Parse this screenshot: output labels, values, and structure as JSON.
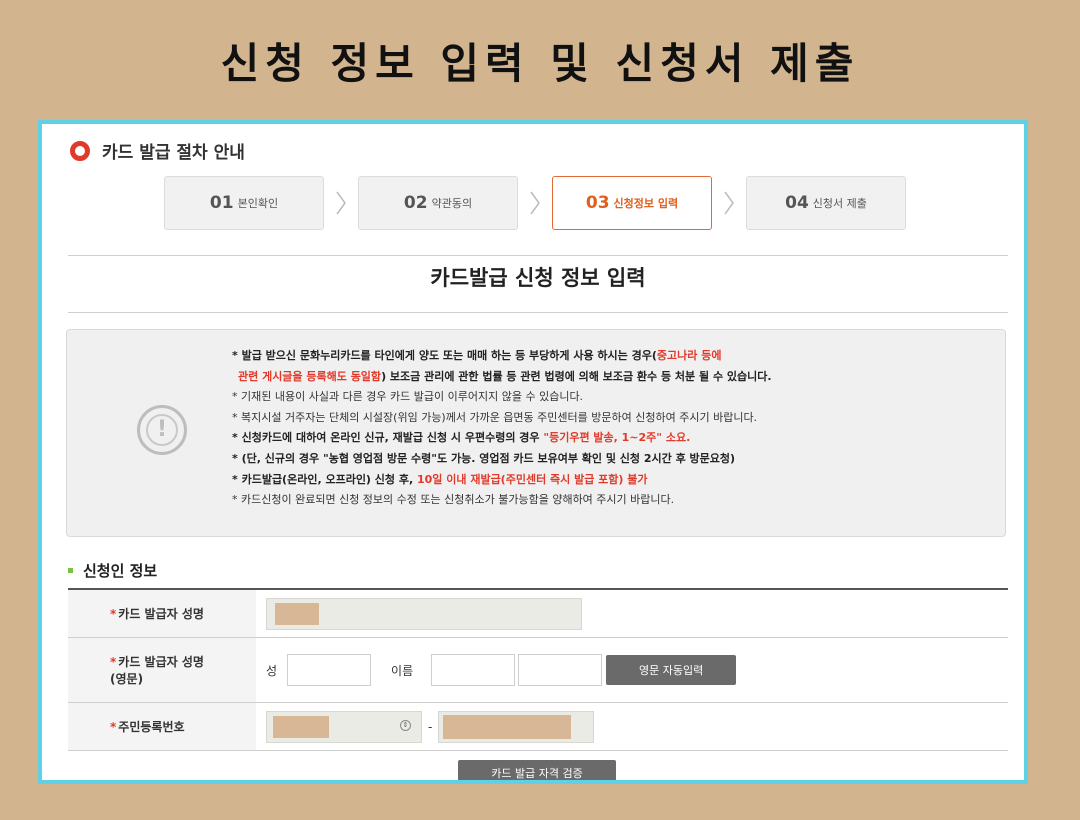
{
  "headline": "신청 정보 입력 및 신청서 제출",
  "guide_title": "카드 발급 절차 안내",
  "steps": [
    {
      "num": "01",
      "label": "본인확인"
    },
    {
      "num": "02",
      "label": "약관동의"
    },
    {
      "num": "03",
      "label": "신청정보 입력"
    },
    {
      "num": "04",
      "label": "신청서 제출"
    }
  ],
  "active_step": 3,
  "section_title": "카드발급 신청 정보 입력",
  "notice": {
    "lines": [
      {
        "pre": "* 발급 받으신 문화누리카드를 타인에게 양도 또는 매매 하는 등 부당하게 사용 하시는 경우(",
        "red": "중고나라 등에",
        "post": ""
      },
      {
        "pre": "",
        "red": "관련 게시글을 등록해도 동일함",
        "post": ") 보조금 관리에 관한 법률 등 관련 법령에 의해 보조금 환수 등 처분 될 수 있습니다."
      },
      {
        "text": "* 기재된 내용이 사실과 다른 경우 카드 발급이 이루어지지 않을 수 있습니다."
      },
      {
        "text": "* 복지시설 거주자는 단체의 시설장(위임 가능)께서 가까운 읍면동 주민센터를 방문하여 신청하여 주시기 바랍니다."
      },
      {
        "pre": "* 신청카드에 대하여 온라인 신규, 재발급 신청 시 우편수령의 경우 ",
        "red": "\"등기우편 발송, 1~2주\" 소요.",
        "post": ""
      },
      {
        "pre": "* (단, 신규의 경우 \"농협 영업점 방문 수령\"도 가능. 영업점 카드 보유여부 확인 및 신청 2시간 후 방문요청)",
        "red": "",
        "post": ""
      },
      {
        "pre": "* 카드발급(온라인, 오프라인) 신청 후, ",
        "red": "10일 이내 재발급(주민센터 즉시 발급 포함) 불가",
        "post": ""
      },
      {
        "text": "* 카드신청이 완료되면 신청 정보의 수정 또는 신청취소가 불가능함을 양해하여 주시기 바랍니다."
      }
    ]
  },
  "applicant_section": "신청인 정보",
  "form": {
    "row1_label": "카드 발급자 성명",
    "row2_label_1": "카드 발급자 성명",
    "row2_label_2": "(영문)",
    "surname_label": "성",
    "given_label": "이름",
    "auto_button": "영문 자동입력",
    "row3_label": "주민등록번호",
    "dash": "-",
    "verify_button": "카드 발급 자격 검증"
  },
  "colors": {
    "accent": "#e0601f",
    "warning_red": "#e23a2a",
    "frame_border": "#5fd0e6",
    "page_bg": "#d2b48f"
  }
}
